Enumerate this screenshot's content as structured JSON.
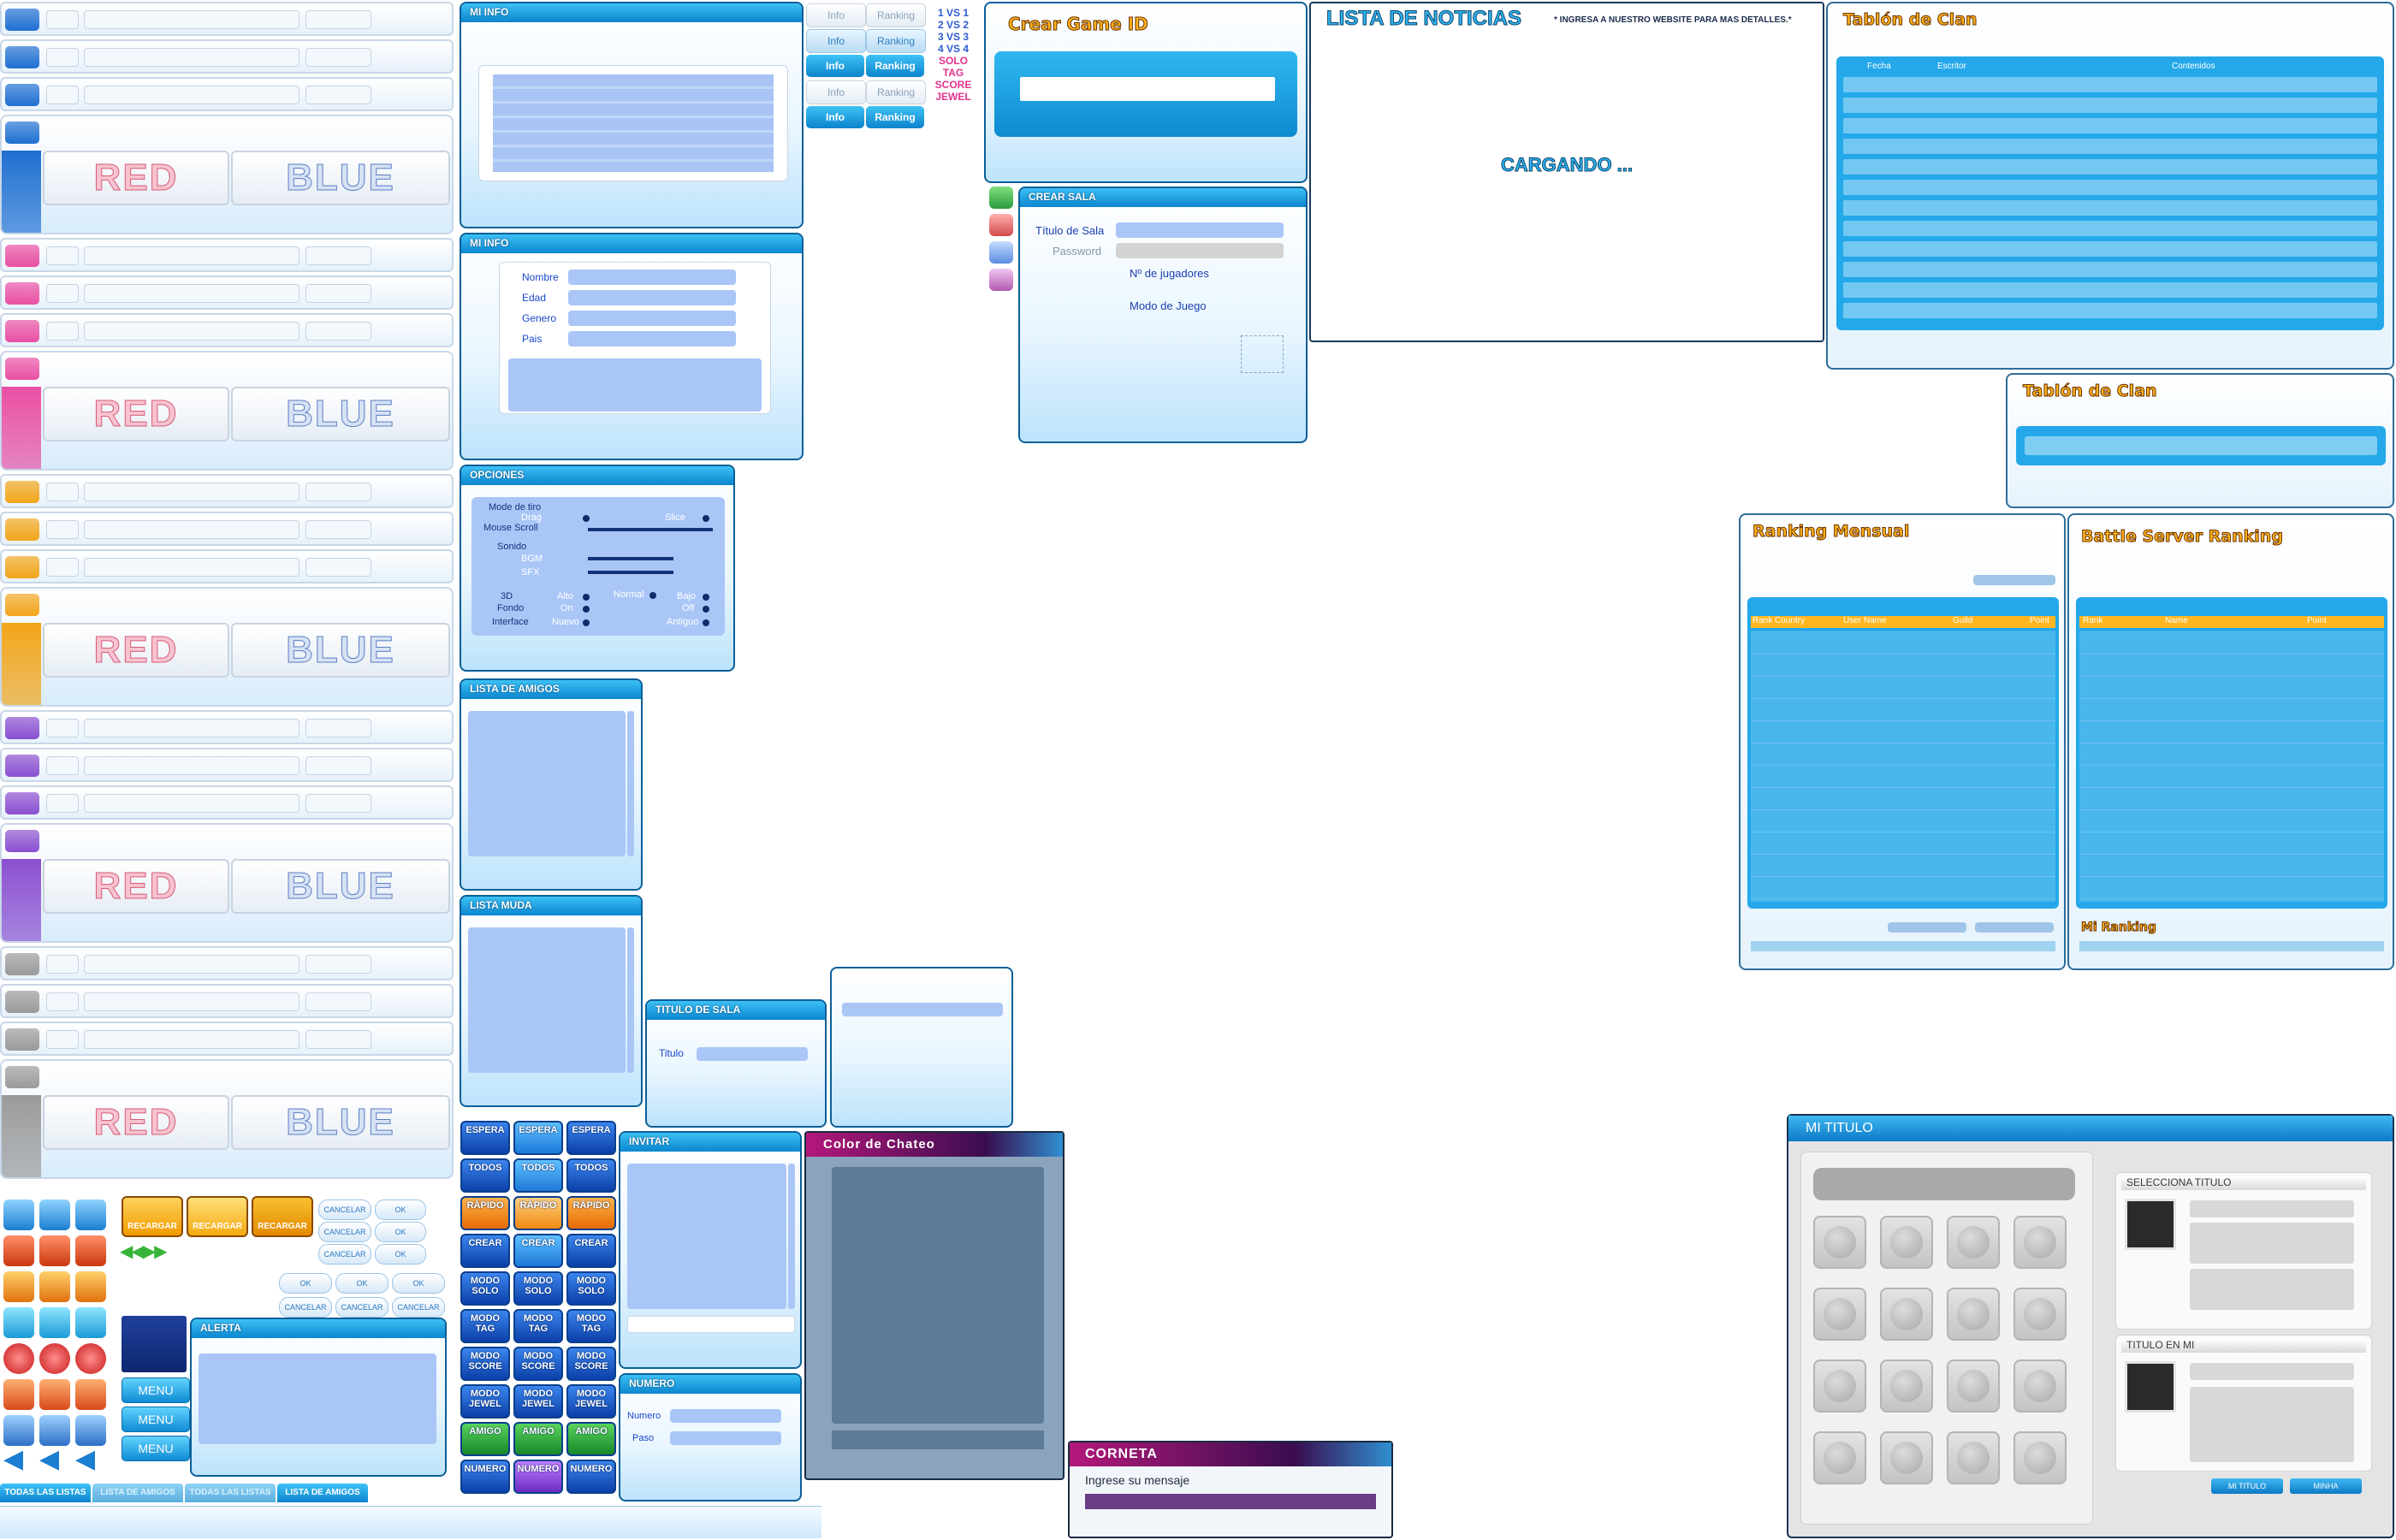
{
  "row_colors": [
    "#1f6fd1",
    "#1f6fd1",
    "#1f6fd1",
    "#e94fa3",
    "#e94fa3",
    "#e94fa3",
    "#f2a51a",
    "#f2a51a",
    "#f2a51a",
    "#8a4fd0",
    "#8a4fd0",
    "#8a4fd0",
    "#9a9a9a",
    "#9a9a9a",
    "#9a9a9a"
  ],
  "teams": {
    "red": "RED",
    "blue": "BLUE"
  },
  "mi_info_1": {
    "title": "MI INFO"
  },
  "mi_info_2": {
    "title": "MI INFO",
    "nombre": "Nombre",
    "edad": "Edad",
    "genero": "Genero",
    "pais": "Pais"
  },
  "opciones": {
    "title": "OPCIONES",
    "modo_de_tiro": "Mode de tiro",
    "drag": "Drag",
    "slice": "Slice",
    "mouse_scroll": "Mouse Scroll",
    "sonido": "Sonido",
    "bgm": "BGM",
    "sfx": "SFX",
    "three_d": "3D",
    "fondo": "Fondo",
    "interface": "Interface",
    "alto": "Alto",
    "normal": "Normal",
    "bajo": "Bajo",
    "on": "On",
    "off": "Off",
    "nuevo": "Nuevo",
    "antiguo": "Antiguo"
  },
  "lista_amigos": {
    "title": "LISTA DE AMIGOS"
  },
  "lista_muda": {
    "title": "LISTA MUDA"
  },
  "titulo_sala": {
    "title": "TITULO DE SALA",
    "field_label": "Titulo"
  },
  "invitar": {
    "title": "INVITAR"
  },
  "numero": {
    "title": "NUMERO",
    "numero_label": "Numero",
    "paso_label": "Paso"
  },
  "alerta": {
    "title": "ALERTA"
  },
  "color_chateo": {
    "title": "Color de Chateo"
  },
  "corneta": {
    "title": "CORNETA",
    "placeholder": "Ingrese su mensaje"
  },
  "tabs": {
    "info": "Info",
    "ranking": "Ranking"
  },
  "mode_labels": [
    "1 VS 1",
    "2 VS 2",
    "3 VS 3",
    "4 VS 4",
    "SOLO",
    "TAG",
    "SCORE",
    "JEWEL"
  ],
  "crear_game_id": {
    "title": "Crear Game ID"
  },
  "crear_sala": {
    "title": "CREAR SALA",
    "titulo_de_sala": "Título de Sala",
    "password": "Password",
    "jugadores": "Nº de jugadores",
    "modo_de_juego": "Modo de Juego"
  },
  "noticias": {
    "title": "LISTA DE NOTICIAS",
    "note": "* INGRESA A NUESTRO WEBSITE PARA MAS DETALLES.*",
    "loading": "CARGANDO ..."
  },
  "clan_board": {
    "title": "Tablón de Clan",
    "col_fecha": "Fecha",
    "col_escritor": "Escritor",
    "col_contenidos": "Contenidos"
  },
  "clan_board_small": {
    "title": "Tablón de Clan"
  },
  "ranking_mensual": {
    "title": "Ranking Mensual",
    "cols": [
      "Rank",
      "Country",
      "User Name",
      "Guild",
      "Point"
    ]
  },
  "battle_ranking": {
    "title": "Battle Server Ranking",
    "cols": [
      "Rank",
      "Name",
      "Point"
    ],
    "mi_ranking": "Mi Ranking"
  },
  "mi_titulo": {
    "title": "MI TITULO",
    "selecciona": "SELECCIONA TITULO",
    "titulo_en_mi": "TITULO EN MI",
    "btn_mi_titulo": "MI TITULO",
    "btn_minha": "MINHA"
  },
  "game_buttons": [
    [
      "ESPERA",
      "ESPERA",
      "ESPERA"
    ],
    [
      "TODOS",
      "TODOS",
      "TODOS"
    ],
    [
      "RÁPIDO",
      "RÁPIDO",
      "RÁPIDO"
    ],
    [
      "CREAR",
      "CREAR",
      "CREAR"
    ],
    [
      "MODO SOLO",
      "MODO SOLO",
      "MODO SOLO"
    ],
    [
      "MODO TAG",
      "MODO TAG",
      "MODO TAG"
    ],
    [
      "MODO SCORE",
      "MODO SCORE",
      "MODO SCORE"
    ],
    [
      "MODO JEWEL",
      "MODO JEWEL",
      "MODO JEWEL"
    ],
    [
      "AMIGO",
      "AMIGO",
      "AMIGO"
    ],
    [
      "NUMERO",
      "NUMERO",
      "NUMERO"
    ]
  ],
  "recargar": "RECARGAR",
  "cancelar": "CANCELAR",
  "ok": "OK",
  "menu": "MENU",
  "bottom_tabs": [
    "TODAS LAS LISTAS",
    "LISTA DE AMIGOS",
    "TODAS LAS LISTAS",
    "LISTA DE AMIGOS"
  ]
}
